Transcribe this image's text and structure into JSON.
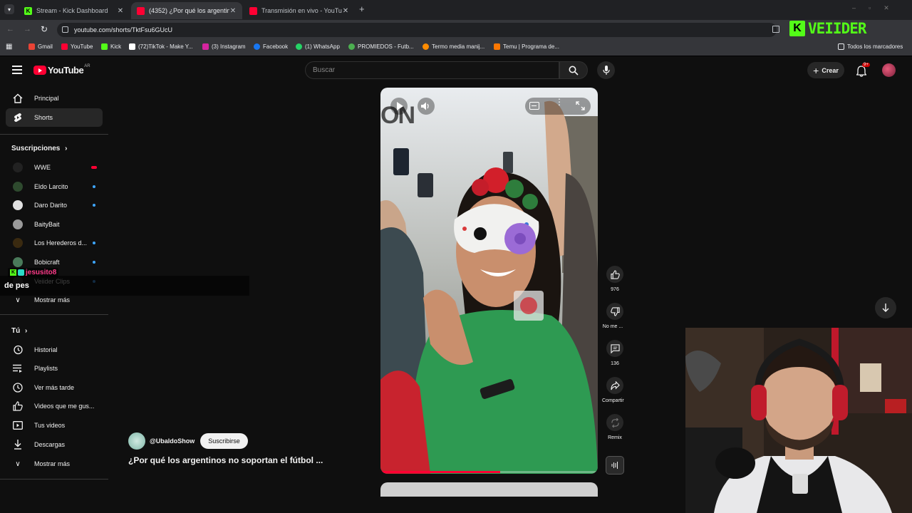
{
  "browser": {
    "tabs": [
      {
        "title": "Stream - Kick Dashboard",
        "active": false,
        "favicon_color": "#53fc18",
        "favicon_letter": "K"
      },
      {
        "title": "(4352) ¿Por qué los argentinos no soportan",
        "active": true,
        "favicon_color": "#ff0033",
        "favicon_letter": ""
      },
      {
        "title": "Transmisión en vivo - YouTube",
        "active": false,
        "favicon_color": "#ff0033",
        "favicon_letter": ""
      }
    ],
    "url": "youtube.com/shorts/TktFsu6GUcU",
    "bookmarks": [
      {
        "label": "Gmail",
        "color": "#ea4335"
      },
      {
        "label": "YouTube",
        "color": "#ff0033"
      },
      {
        "label": "Kick",
        "color": "#53fc18"
      },
      {
        "label": "(72)TikTok - Make Y...",
        "color": "#ffffff"
      },
      {
        "label": "(3) Instagram",
        "color": "#d6249f"
      },
      {
        "label": "Facebook",
        "color": "#1877f2"
      },
      {
        "label": "(1) WhatsApp",
        "color": "#25d366"
      },
      {
        "label": "PROMIEDOS - Futb...",
        "color": "#4caf50"
      },
      {
        "label": "Termo media manij...",
        "color": "#ff8c00"
      },
      {
        "label": "Temu | Programa de...",
        "color": "#fb7701"
      }
    ],
    "all_bookmarks": "Todos los marcadores"
  },
  "overlay": {
    "logo_text": "VEIIDER",
    "logo_letter": "K",
    "accent": "#53fc18",
    "chat_user": "jesusito8",
    "chat_text": "de pes"
  },
  "youtube": {
    "logo": "YouTube",
    "region": "AR",
    "search_placeholder": "Buscar",
    "create_label": "Crear",
    "notif_count": "9+",
    "nav": [
      {
        "label": "Principal",
        "icon": "home-icon"
      },
      {
        "label": "Shorts",
        "icon": "shorts-icon",
        "selected": true
      }
    ],
    "subs_title": "Suscripciones",
    "subscriptions": [
      {
        "label": "WWE",
        "live": true,
        "avatar_color": "#222222"
      },
      {
        "label": "Eldo Larcito",
        "dot": true,
        "avatar_color": "#2e4a2e"
      },
      {
        "label": "Daro Darito",
        "dot": true,
        "avatar_color": "#e0e0e0"
      },
      {
        "label": "BaityBait",
        "dot": false,
        "avatar_color": "#9a9a9a"
      },
      {
        "label": "Los Herederos d...",
        "dot": true,
        "avatar_color": "#3a2a10"
      },
      {
        "label": "Bobicraft",
        "dot": true,
        "avatar_color": "#4a7a5a"
      },
      {
        "label": "Veiider Clips",
        "dot": true,
        "avatar_color": "#333333"
      }
    ],
    "show_more_1": "Mostrar más",
    "you_title": "Tú",
    "you_items": [
      {
        "label": "Historial",
        "icon": "history-icon"
      },
      {
        "label": "Playlists",
        "icon": "playlists-icon"
      },
      {
        "label": "Ver más tarde",
        "icon": "watch-later-icon"
      },
      {
        "label": "Videos que me gus...",
        "icon": "liked-icon"
      },
      {
        "label": "Tus videos",
        "icon": "your-videos-icon"
      },
      {
        "label": "Descargas",
        "icon": "downloads-icon"
      }
    ],
    "show_more_2": "Mostrar más"
  },
  "short": {
    "channel": "@UbaldoShow",
    "subscribe": "Suscribirse",
    "title": "¿Por qué los argentinos no soportan el fútbol ...",
    "likes": "976",
    "dislike_label": "No me ...",
    "comments": "136",
    "share_label": "Compartir",
    "remix_label": "Remix",
    "watermark": "ON",
    "progress": 0.55
  }
}
